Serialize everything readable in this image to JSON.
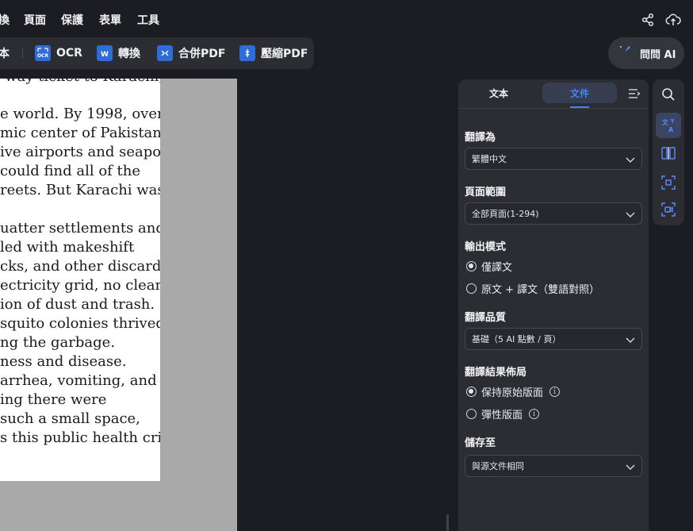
{
  "menubar": {
    "items": [
      "換",
      "頁面",
      "保護",
      "表單",
      "工具"
    ]
  },
  "toolbar": {
    "partial_label": "本",
    "ocr_label": "OCR",
    "convert_label": "轉換",
    "merge_label": "合併PDF",
    "compress_label": "壓縮PDF",
    "ask_ai_label": "問問 AI"
  },
  "document": {
    "lines": [
      "-way ticket to Karachi,",
      "",
      "e world. By 1998, over",
      "mic center of Pakistan",
      "ive airports and seaports",
      "could find all of the",
      "reets. But Karachi was",
      "",
      "uatter settlements and",
      "led with makeshift",
      "cks, and other discarded",
      "ectricity grid, no clean",
      "ion of dust and trash.",
      "squito colonies thrived",
      "ng the garbage.",
      "ness and disease.",
      "arrhea, vomiting, and",
      "ing there were",
      "such a small space,",
      "s this public health crisis"
    ]
  },
  "panel": {
    "tab_text": "文本",
    "tab_document": "文件",
    "translate_to_label": "翻譯為",
    "translate_to_value": "繁體中文",
    "page_range_label": "頁面範圍",
    "page_range_value": "全部頁面(1-294)",
    "output_mode_label": "輸出模式",
    "output_mode_options": [
      "僅譯文",
      "原文 + 譯文（雙語對照）"
    ],
    "quality_label": "翻譯品質",
    "quality_value": "基礎（5 AI 點數 / 頁）",
    "layout_label": "翻譯結果佈局",
    "layout_options": [
      "保持原始版面",
      "彈性版面"
    ],
    "save_to_label": "儲存至",
    "save_to_value": "與源文件相同"
  },
  "colors": {
    "accent": "#3f86ff",
    "background": "#1c1d22",
    "panel": "#2b2d33"
  }
}
